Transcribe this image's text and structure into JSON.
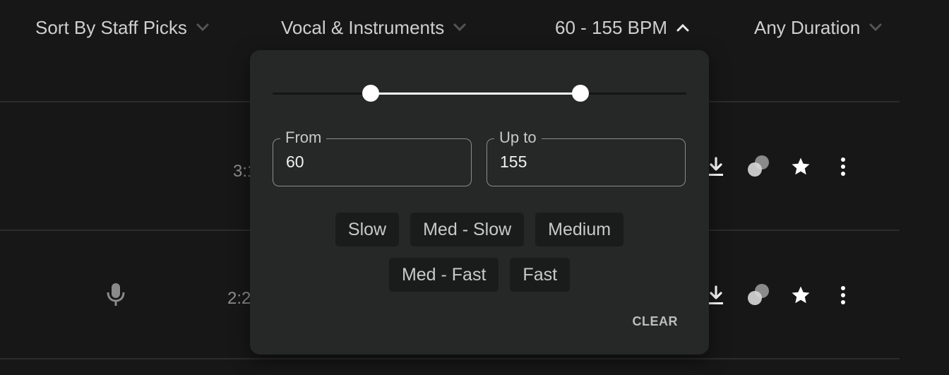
{
  "filters": {
    "sort": {
      "label": "Sort By Staff Picks",
      "icon": "chevron-down-icon"
    },
    "vocals": {
      "label": "Vocal & Instruments",
      "icon": "chevron-down-icon"
    },
    "bpm": {
      "label": "60 - 155 BPM",
      "icon": "chevron-up-icon",
      "expanded": true
    },
    "duration": {
      "label": "Any Duration",
      "icon": "chevron-down-icon"
    }
  },
  "tracks": [
    {
      "duration": "3:1",
      "vocal_icon": false,
      "actions": [
        "download-icon",
        "similar-icon",
        "star-icon",
        "more-vertical-icon"
      ]
    },
    {
      "duration": "2:2",
      "vocal_icon": true,
      "vocal_icon_name": "microphone-icon",
      "actions": [
        "download-icon",
        "similar-icon",
        "star-icon",
        "more-vertical-icon"
      ]
    }
  ],
  "bpm_popover": {
    "slider": {
      "min_fraction": 0.237,
      "max_fraction": 0.744
    },
    "from": {
      "label": "From",
      "value": "60"
    },
    "to": {
      "label": "Up to",
      "value": "155"
    },
    "presets_row1": [
      "Slow",
      "Med - Slow",
      "Medium"
    ],
    "presets_row2": [
      "Med - Fast",
      "Fast"
    ],
    "clear_label": "CLEAR"
  },
  "colors": {
    "background": "#171717",
    "popover": "#262727",
    "accent": "#ffffff"
  }
}
